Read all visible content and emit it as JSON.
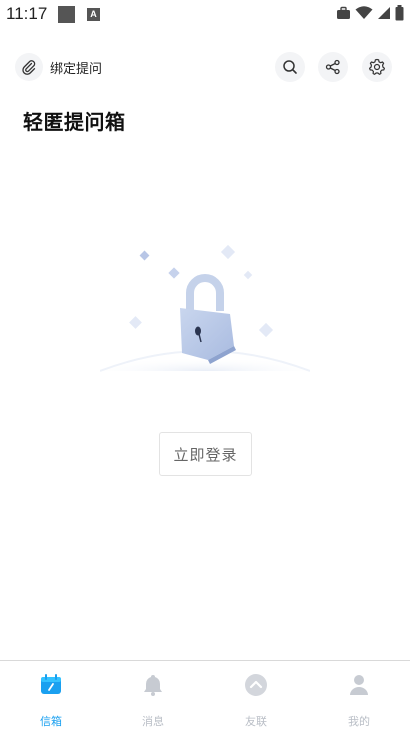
{
  "status_bar": {
    "time": "11:17",
    "notification_icons": [
      "stop-square-icon",
      "a-app-icon"
    ],
    "system_icons": [
      "briefcase-icon",
      "wifi-icon",
      "signal-icon",
      "battery-icon"
    ],
    "a_glyph": "A"
  },
  "top_bar": {
    "bind_label": "绑定提问",
    "actions": [
      "search-icon",
      "share-icon",
      "gear-icon"
    ]
  },
  "page": {
    "title": "轻匿提问箱",
    "illustration": "lock-icon",
    "login_button": "立即登录"
  },
  "bottom_nav": {
    "items": [
      {
        "label": "信箱",
        "icon": "mailbox-icon",
        "active": true
      },
      {
        "label": "消息",
        "icon": "bell-icon",
        "active": false
      },
      {
        "label": "友联",
        "icon": "chevron-up-circle-icon",
        "active": false
      },
      {
        "label": "我的",
        "icon": "person-icon",
        "active": false
      }
    ]
  },
  "colors": {
    "accent": "#1aa0f0",
    "inactive": "#b9bec6",
    "chip_background": "#f3f4f6"
  }
}
